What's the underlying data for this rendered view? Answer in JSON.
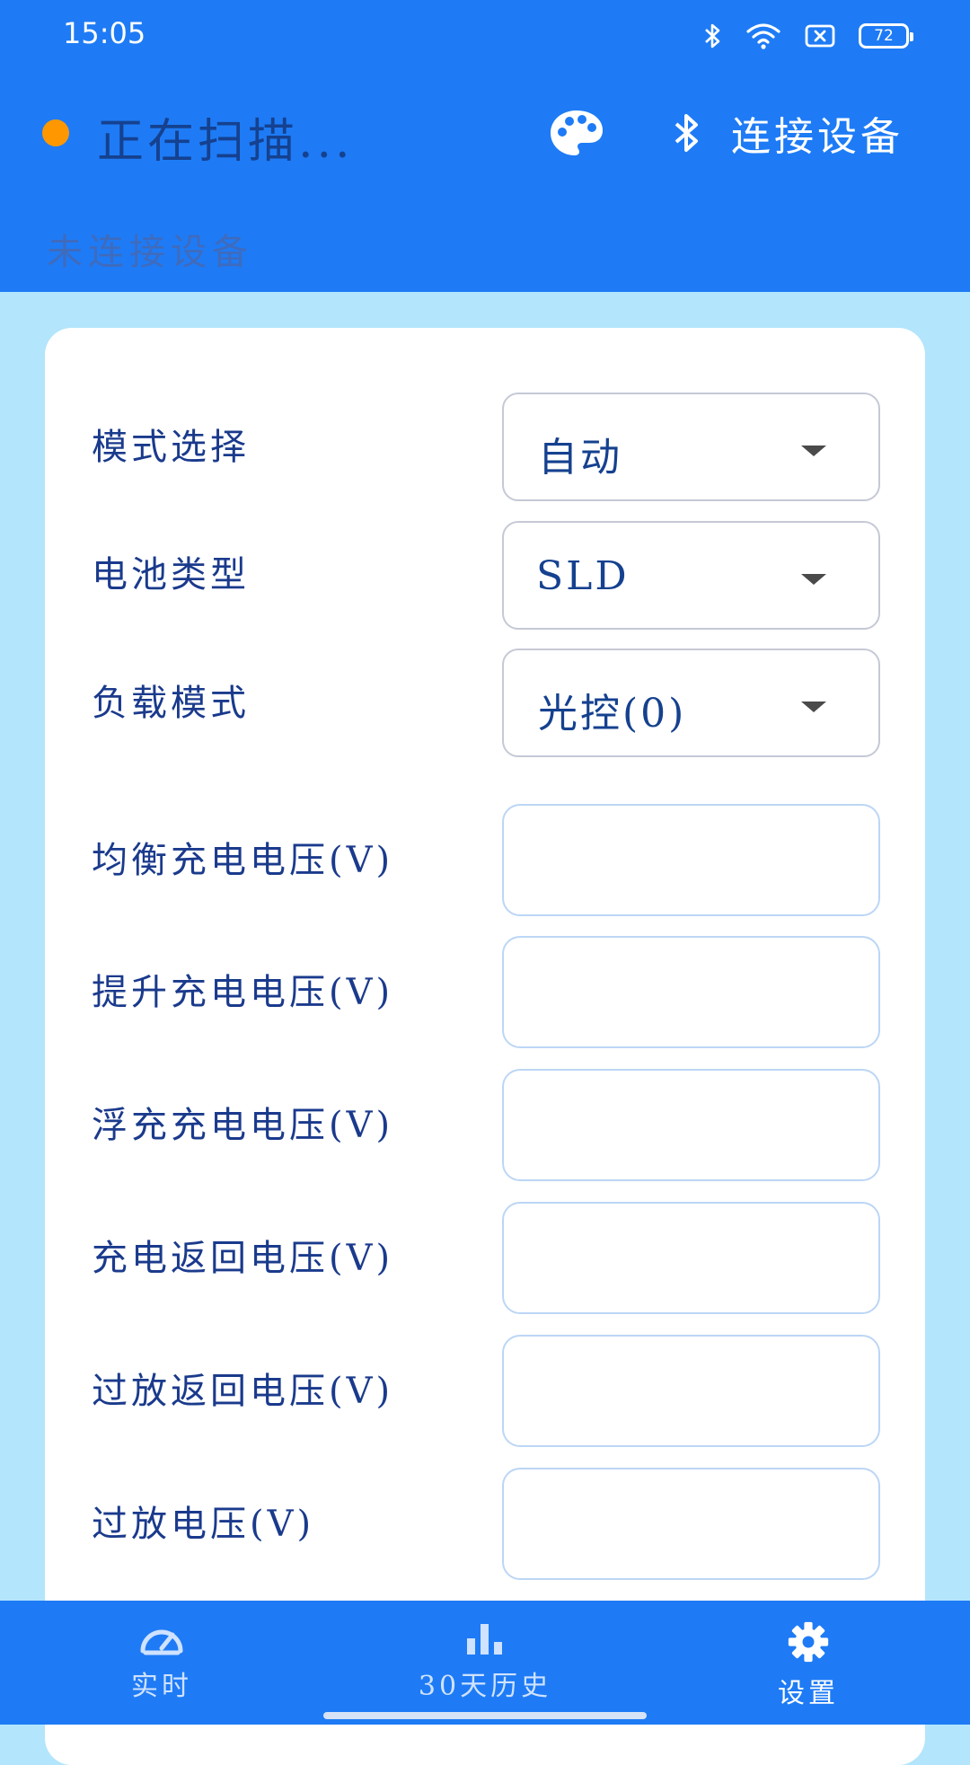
{
  "status_bar": {
    "time": "15:05",
    "battery": "72"
  },
  "header": {
    "scan_status": "正在扫描...",
    "connect_label": "连接设备",
    "subtitle": "未连接设备"
  },
  "colors": {
    "primary": "#1e7bf5",
    "background": "#b3e5fc",
    "scan_dot": "#ff9800",
    "text": "#15418f"
  },
  "settings": {
    "selects": [
      {
        "label": "模式选择",
        "value": "自动"
      },
      {
        "label": "电池类型",
        "value": "SLD"
      },
      {
        "label": "负载模式",
        "value": "光控(0)"
      }
    ],
    "inputs": [
      {
        "label": "均衡充电电压(V)",
        "value": ""
      },
      {
        "label": "提升充电电压(V)",
        "value": ""
      },
      {
        "label": "浮充充电电压(V)",
        "value": ""
      },
      {
        "label": "充电返回电压(V)",
        "value": ""
      },
      {
        "label": "过放返回电压(V)",
        "value": ""
      },
      {
        "label": "过放电压(V)",
        "value": ""
      }
    ]
  },
  "nav": {
    "items": [
      {
        "label": "实时",
        "icon": "speedometer-icon"
      },
      {
        "label": "30天历史",
        "icon": "bar-chart-icon"
      },
      {
        "label": "设置",
        "icon": "gear-icon",
        "active": true
      }
    ]
  }
}
